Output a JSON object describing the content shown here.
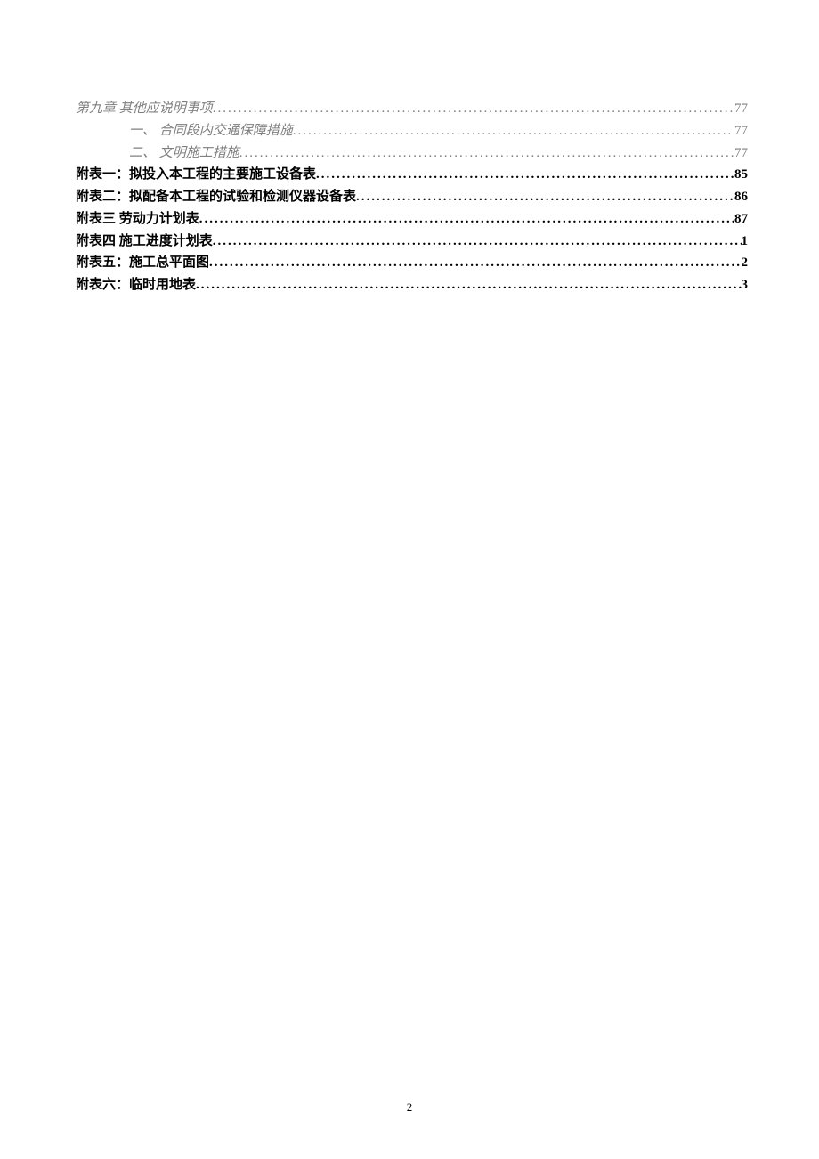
{
  "toc": [
    {
      "level": 1,
      "label": "第九章  其他应说明事项",
      "page": "77"
    },
    {
      "level": 2,
      "label": "一、 合同段内交通保障措施",
      "page": "77"
    },
    {
      "level": 2,
      "label": "二、 文明施工措施",
      "page": "77"
    },
    {
      "level": 0,
      "label": "附表一：拟投入本工程的主要施工设备表",
      "page": "85"
    },
    {
      "level": 0,
      "label": "附表二：拟配备本工程的试验和检测仪器设备表",
      "page": "86"
    },
    {
      "level": 0,
      "label": "附表三   劳动力计划表 ",
      "page": "87"
    },
    {
      "level": 0,
      "label": "附表四   施工进度计划表 ",
      "page": "1"
    },
    {
      "level": 0,
      "label": "附表五：施工总平面图 ",
      "page": "2"
    },
    {
      "level": 0,
      "label": "附表六：临时用地表 ",
      "page": "3"
    }
  ],
  "pageNumber": "2"
}
